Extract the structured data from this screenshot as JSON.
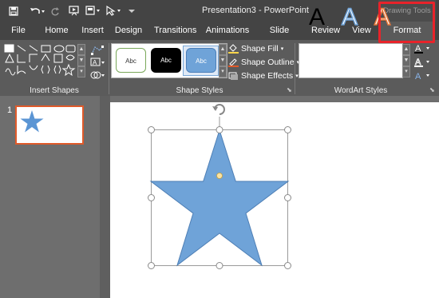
{
  "app": {
    "title": "Presentation3 - PowerPoint",
    "contextual_tab_group": "Drawing Tools"
  },
  "tabs": [
    {
      "label": "File"
    },
    {
      "label": "Home"
    },
    {
      "label": "Insert"
    },
    {
      "label": "Design"
    },
    {
      "label": "Transitions"
    },
    {
      "label": "Animations"
    },
    {
      "label": "Slide Show"
    },
    {
      "label": "Review"
    },
    {
      "label": "View"
    },
    {
      "label": "Format",
      "selected": true
    }
  ],
  "ribbon": {
    "groups": {
      "insert_shapes": "Insert Shapes",
      "shape_styles": "Shape Styles",
      "wordart_styles": "WordArt Styles"
    },
    "style_thumbs": [
      "Abc",
      "Abc",
      "Abc"
    ],
    "shape_fill": "Shape Fill",
    "shape_outline": "Shape Outline",
    "shape_effects": "Shape Effects",
    "wordart_letters": [
      "A",
      "A",
      "A"
    ]
  },
  "slides": {
    "current_number": "1"
  },
  "colors": {
    "accent_red": "#e8232a",
    "shape_fill": "#6fa3d8",
    "selected_thumb_border": "#e05a2a"
  }
}
